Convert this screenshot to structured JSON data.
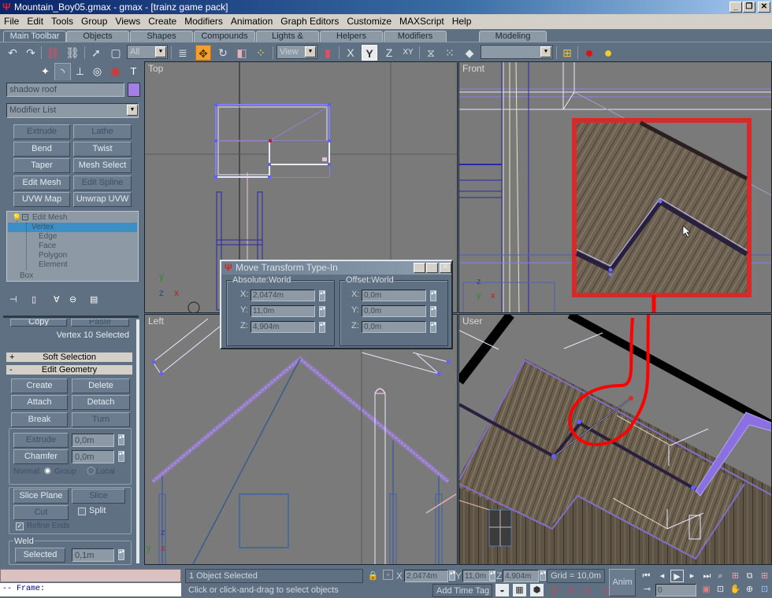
{
  "window": {
    "title": "Mountain_Boy05.gmax - gmax - [trainz game pack]",
    "logo_icon": "gmax-logo-icon",
    "controls": {
      "minimize": "_",
      "restore": "❐",
      "close": "✕"
    }
  },
  "menu": [
    "File",
    "Edit",
    "Tools",
    "Group",
    "Views",
    "Create",
    "Modifiers",
    "Animation",
    "Graph Editors",
    "Customize",
    "MAXScript",
    "Help"
  ],
  "toolbar_tabs": [
    {
      "label": "Main Toolbar",
      "active": true
    },
    {
      "label": "Objects"
    },
    {
      "label": "Shapes"
    },
    {
      "label": "Compounds"
    },
    {
      "label": "Lights & Cameras"
    },
    {
      "label": "Helpers"
    },
    {
      "label": "Modifiers"
    },
    {
      "label": "Modeling"
    }
  ],
  "toolbar": {
    "undo_icon": "↶",
    "redo_icon": "↷",
    "link_icon": "⛓",
    "unlink_icon": "⛓",
    "select_icon": "➚",
    "region_icon": "▢",
    "filter_value": "All",
    "select_by_name_icon": "≣",
    "move_icon": "✥",
    "rotate_icon": "↻",
    "scale_icon": "◧",
    "pivot_icon": "⁘",
    "refcoord_value": "View",
    "center_icon": "▮",
    "axis_x": "X",
    "axis_y": "Y",
    "axis_z": "Z",
    "axis_xy": "XY",
    "mirror_icon": "⧖",
    "array_icon": "⁙",
    "align_icon": "◆",
    "named_sel_value": "",
    "snap_icon": "⊞",
    "material_icon": "●",
    "render_icon": "●"
  },
  "command_panel": {
    "tab_icons": [
      "create-icon",
      "modify-icon",
      "hierarchy-icon",
      "motion-icon",
      "display-icon",
      "utilities-icon"
    ],
    "tab_glyphs": [
      "✦",
      "◝",
      "⊥",
      "◎",
      "▣",
      "T"
    ],
    "object_name": "shadow roof",
    "object_color": "#a37ee6",
    "modifier_list": "Modifier List",
    "modifier_buttons": [
      {
        "label": "Extrude",
        "enabled": false
      },
      {
        "label": "Lathe",
        "enabled": false
      },
      {
        "label": "Bend",
        "enabled": true
      },
      {
        "label": "Twist",
        "enabled": true
      },
      {
        "label": "Taper",
        "enabled": true
      },
      {
        "label": "Mesh Select",
        "enabled": true
      },
      {
        "label": "Edit Mesh",
        "enabled": true
      },
      {
        "label": "Edit Spline",
        "enabled": false
      },
      {
        "label": "UVW Map",
        "enabled": true
      },
      {
        "label": "Unwrap UVW",
        "enabled": true
      }
    ],
    "stack": {
      "root": "Edit Mesh",
      "subobjects": [
        "Vertex",
        "Edge",
        "Face",
        "Polygon",
        "Element"
      ],
      "selected": "Vertex",
      "base": "Box"
    },
    "stack_tool_icons": [
      "pin-stack-icon",
      "show-end-result-icon",
      "make-unique-icon",
      "remove-modifier-icon",
      "configure-sets-icon"
    ],
    "selection": {
      "copy_label": "Copy",
      "paste_label": "Paste",
      "status": "Vertex 10 Selected"
    },
    "rollouts": {
      "soft_selection": {
        "sign": "+",
        "label": "Soft Selection"
      },
      "edit_geometry": {
        "sign": "-",
        "label": "Edit Geometry"
      }
    },
    "edit_geometry": {
      "create": "Create",
      "delete": "Delete",
      "attach": "Attach",
      "detach": "Detach",
      "break": "Break",
      "turn": "Turn",
      "extrude": "Extrude",
      "extrude_value": "0,0m",
      "chamfer": "Chamfer",
      "chamfer_value": "0,0m",
      "normal_label": "Normal:",
      "group_label": "Group",
      "local_label": "Local",
      "normal_selected": "Group",
      "slice_plane": "Slice Plane",
      "slice": "Slice",
      "cut": "Cut",
      "split_label": "Split",
      "split_checked": false,
      "refine_ends_label": "Refine Ends",
      "refine_ends_checked": true,
      "weld_label": "Weld",
      "weld_selected": "Selected",
      "weld_value": "0,1m"
    }
  },
  "viewports": {
    "top": {
      "label": "Top"
    },
    "front": {
      "label": "Front"
    },
    "left": {
      "label": "Left"
    },
    "user": {
      "label": "User"
    }
  },
  "transform_dialog": {
    "title": "Move Transform Type-In",
    "absolute_label": "Absolute:World",
    "offset_label": "Offset:World",
    "absolute": {
      "x": "2,0474m",
      "y": "11,0m",
      "z": "4,904m"
    },
    "offset": {
      "x": "0,0m",
      "y": "0,0m",
      "z": "0,0m"
    },
    "axis_labels": {
      "x": "X:",
      "y": "Y:",
      "z": "Z:"
    }
  },
  "status_bar": {
    "maxscript_output": "-- Frame:",
    "selection_status": "1 Object Selected",
    "prompt": "Click or click-and-drag to select objects",
    "coords": {
      "x_label": "X",
      "x": "2,0474m",
      "y_label": "Y",
      "y": "11,0m",
      "z_label": "Z",
      "z": "4,904m"
    },
    "grid": "Grid = 10,0m",
    "add_time_tag": "Add Time Tag",
    "anim": "Anim",
    "frame_value": "0",
    "playback_icons": [
      "go-to-start-icon",
      "previous-frame-icon",
      "play-icon",
      "next-frame-icon",
      "go-to-end-icon"
    ],
    "playback_glyphs": [
      "⏮",
      "◂",
      "▶",
      "▸",
      "⏭"
    ],
    "nav_glyphs": [
      "🔍",
      "⊞",
      "⧉",
      "⊞",
      "⊡",
      "✋",
      "⊕",
      "⊡"
    ]
  }
}
